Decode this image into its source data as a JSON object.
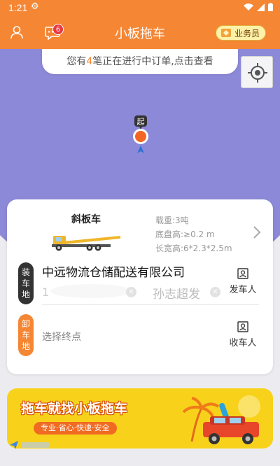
{
  "status_bar": {
    "time": "1:21"
  },
  "header": {
    "title": "小板拖车",
    "message_badge": "6",
    "staff_label": "业务员"
  },
  "map": {
    "order_notice_prefix": "您有",
    "order_count": "4",
    "order_notice_suffix": "笔正在进行中订单,点击查看",
    "start_marker_label": "起"
  },
  "vehicle": {
    "name": "斜板车",
    "specs": [
      "载重:3吨",
      "底盘高:≥0.2 m",
      "长宽高:6*2.3*2.5m"
    ]
  },
  "loading": {
    "tag": "装车地",
    "company": "中远物流仓储配送有限公司",
    "contact_name": "孙志超发",
    "sender_label": "发车人"
  },
  "unloading": {
    "tag": "卸车地",
    "placeholder": "选择终点",
    "receiver_label": "收车人"
  },
  "ad": {
    "headline": "拖车就找小板拖车",
    "tagline": "专业·省心·快速·安全"
  },
  "colors": {
    "brand": "#f58634",
    "map_circle": "#8c89d8",
    "ad_bg": "#f8d21a"
  }
}
